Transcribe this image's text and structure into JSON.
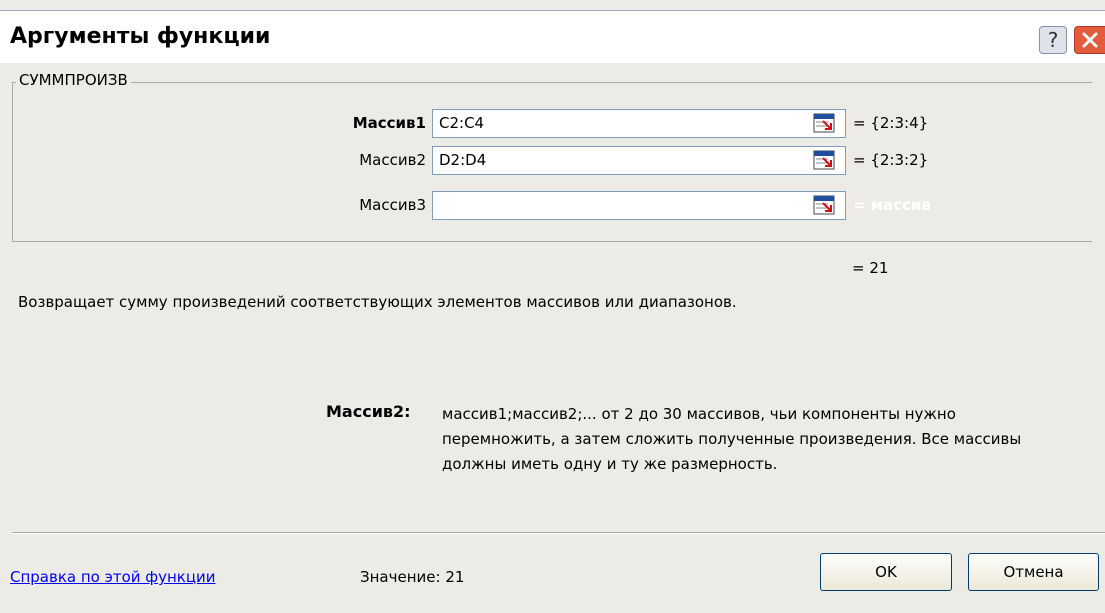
{
  "window": {
    "title": "Аргументы функции",
    "help_glyph": "?",
    "help_icon": "question-icon",
    "close_icon": "close-icon"
  },
  "function_name": "СУММПРОИЗВ",
  "arguments": [
    {
      "label": "Массив1",
      "value": "C2:C4",
      "result": "= {2:3:4}"
    },
    {
      "label": "Массив2",
      "value": "D2:D4",
      "result": "= {2:3:2}"
    },
    {
      "label": "Массив3",
      "value": "",
      "result": "= массив"
    }
  ],
  "formula_result": "= 21",
  "description": "Возвращает сумму произведений соответствующих элементов массивов или диапазонов.",
  "parameter": {
    "name": "Массив2:",
    "description": "массив1;массив2;... от 2 до 30 массивов, чьи компоненты нужно перемножить, а затем сложить полученные произведения. Все массивы должны иметь одну и ту же размерность."
  },
  "footer": {
    "help_link": "Справка по этой функции",
    "value_label": "Значение: 21",
    "ok_label": "OK",
    "cancel_label": "Отмена"
  },
  "colors": {
    "dialog_bg": "#ecebe5",
    "link": "#0000ee",
    "close_red": "#e35a3c"
  }
}
